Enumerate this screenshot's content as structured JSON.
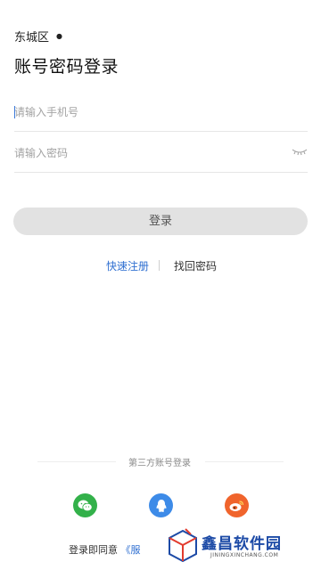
{
  "header": {
    "district": "东城区",
    "title": "账号密码登录"
  },
  "form": {
    "phone_placeholder": "请输入手机号",
    "password_placeholder": "请输入密码",
    "login_label": "登录"
  },
  "links": {
    "register": "快速注册",
    "forgot": "找回密码"
  },
  "third_party": {
    "title": "第三方账号登录",
    "icons": [
      "wechat-icon",
      "qq-icon",
      "weibo-icon"
    ],
    "colors": {
      "wechat": "#33b14a",
      "qq": "#3d8be8",
      "weibo": "#f0642c"
    }
  },
  "agreement": {
    "prefix": "登录即同意",
    "link": "《服"
  },
  "watermark": {
    "title": "鑫昌软件园",
    "subtitle": "JININGXINCHANG.COM"
  },
  "theme": {
    "accent": "#2f6fd1",
    "button_bg": "#e2e2e2"
  }
}
